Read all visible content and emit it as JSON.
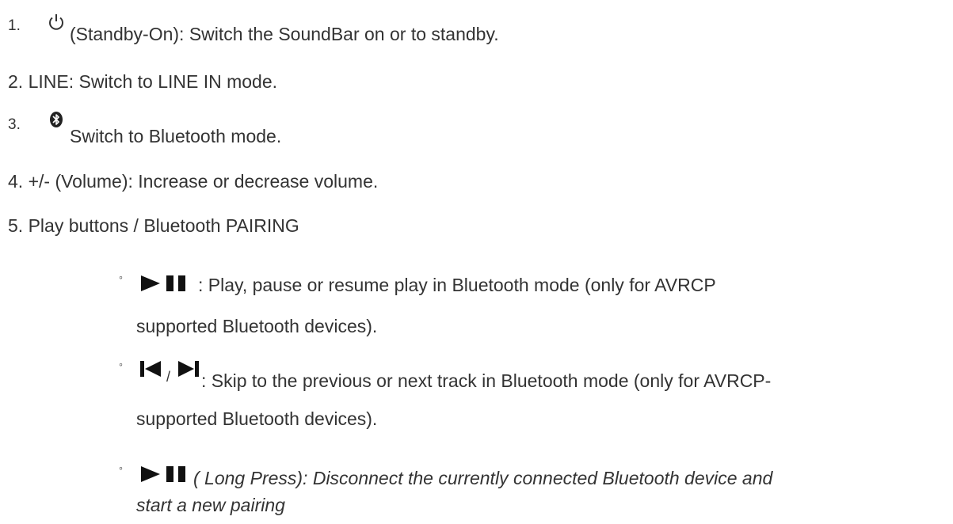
{
  "items": [
    {
      "num": "1.",
      "icon": "power-icon",
      "text": "(Standby-On): Switch the SoundBar on or to standby."
    },
    {
      "num": "2.",
      "text": "LINE: Switch to LINE IN mode."
    },
    {
      "num": "3.",
      "icon": "bluetooth-icon",
      "text": "Switch to Bluetooth mode."
    },
    {
      "num": "4.",
      "text": "+/- (Volume): Increase or decrease volume."
    },
    {
      "num": "5.",
      "text": "Play buttons / Bluetooth PAIRING"
    }
  ],
  "subitems": [
    {
      "bullet": "◦",
      "icon": "play-pause-icon",
      "line1": ": Play, pause or resume play in Bluetooth mode (only for AVRCP",
      "line2": "supported Bluetooth devices)."
    },
    {
      "bullet": "◦",
      "icon": "prev-next-icon",
      "separator": "/",
      "line1": ": Skip to the previous or next track in Bluetooth mode (only for AVRCP-",
      "line2": "supported Bluetooth devices)."
    },
    {
      "bullet": "◦",
      "icon": "play-pause-icon",
      "line1": "( Long Press): Disconnect the currently connected Bluetooth device and",
      "line2": "start a new pairing"
    }
  ]
}
